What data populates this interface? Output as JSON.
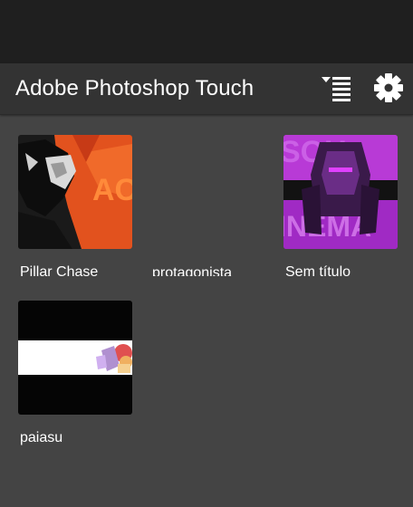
{
  "app_bar": {
    "title": "Adobe Photoshop Touch",
    "sort_icon": "sort-list-icon",
    "settings_icon": "gear-icon"
  },
  "documents": [
    {
      "name": "Pillar Chase",
      "thumbnail": "dark figure with red splash art"
    },
    {
      "name": "protagonista",
      "thumbnail": ""
    },
    {
      "name": "Sem título",
      "thumbnail": "purple cinema poster art"
    },
    {
      "name": "paiasu",
      "thumbnail": "white banner with small character"
    }
  ],
  "colors": {
    "status_bar": "#1f1f1f",
    "app_bar": "#333333",
    "background": "#444444",
    "text": "#ffffff"
  }
}
